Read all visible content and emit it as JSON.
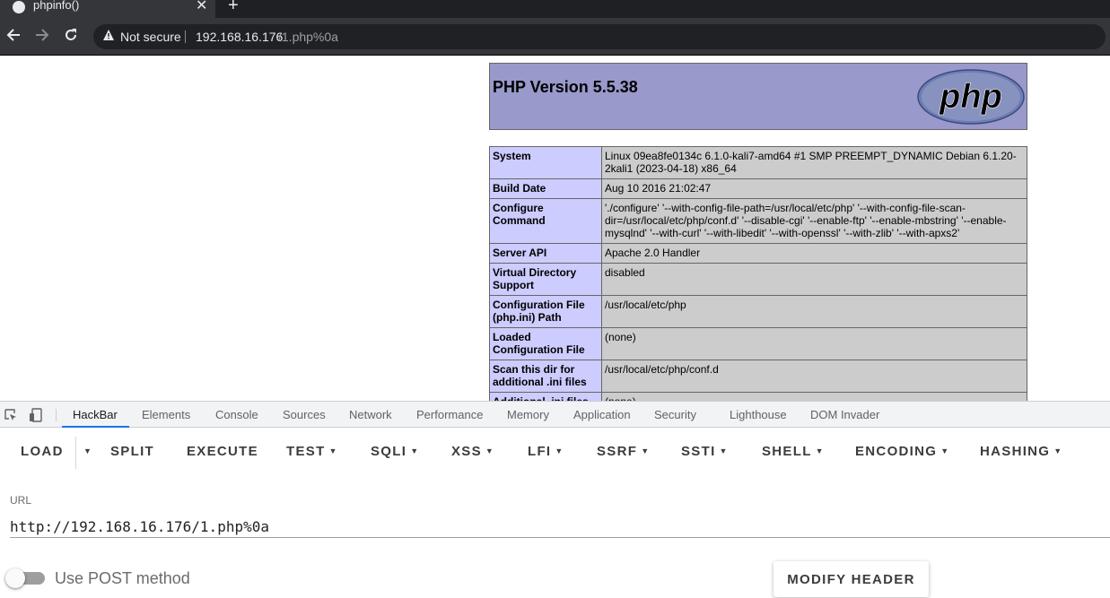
{
  "browser": {
    "tab_title": "phpinfo()",
    "close_glyph": "✕",
    "new_tab_glyph": "+",
    "not_secure": "Not secure",
    "url_host": "192.168.16.176",
    "url_path": "/1.php%0a",
    "icons": {
      "back": "arrow-left-icon",
      "forward": "arrow-right-icon",
      "reload": "reload-icon",
      "warning": "warning-triangle-icon"
    }
  },
  "page": {
    "title": "PHP Version 5.5.38",
    "logo_text": "php",
    "rows": [
      {
        "label": "System",
        "value": "Linux 09ea8fe0134c 6.1.0-kali7-amd64 #1 SMP PREEMPT_DYNAMIC Debian 6.1.20-2kali1 (2023-04-18) x86_64"
      },
      {
        "label": "Build Date",
        "value": "Aug 10 2016 21:02:47"
      },
      {
        "label": "Configure Command",
        "value": "'./configure' '--with-config-file-path=/usr/local/etc/php' '--with-config-file-scan-dir=/usr/local/etc/php/conf.d' '--disable-cgi' '--enable-ftp' '--enable-mbstring' '--enable-mysqlnd' '--with-curl' '--with-libedit' '--with-openssl' '--with-zlib' '--with-apxs2'"
      },
      {
        "label": "Server API",
        "value": "Apache 2.0 Handler"
      },
      {
        "label": "Virtual Directory Support",
        "value": "disabled"
      },
      {
        "label": "Configuration File (php.ini) Path",
        "value": "/usr/local/etc/php"
      },
      {
        "label": "Loaded Configuration File",
        "value": "(none)"
      },
      {
        "label": "Scan this dir for additional .ini files",
        "value": "/usr/local/etc/php/conf.d"
      },
      {
        "label": "Additional .ini files",
        "value": "(none)"
      }
    ]
  },
  "devtools": {
    "tabs": [
      "HackBar",
      "Elements",
      "Console",
      "Sources",
      "Network",
      "Performance",
      "Memory",
      "Application",
      "Security",
      "Lighthouse",
      "DOM Invader"
    ],
    "active_tab": "HackBar"
  },
  "hackbar": {
    "buttons": {
      "load": "LOAD",
      "split": "SPLIT",
      "execute": "EXECUTE",
      "test": "TEST",
      "sqli": "SQLI",
      "xss": "XSS",
      "lfi": "LFI",
      "ssrf": "SSRF",
      "ssti": "SSTI",
      "shell": "SHELL",
      "encoding": "ENCODING",
      "hashing": "HASHING"
    },
    "url_label": "URL",
    "url_value": "http://192.168.16.176/1.php%0a",
    "post_label": "Use POST method",
    "post_enabled": false,
    "modify_header": "MODIFY HEADER"
  }
}
